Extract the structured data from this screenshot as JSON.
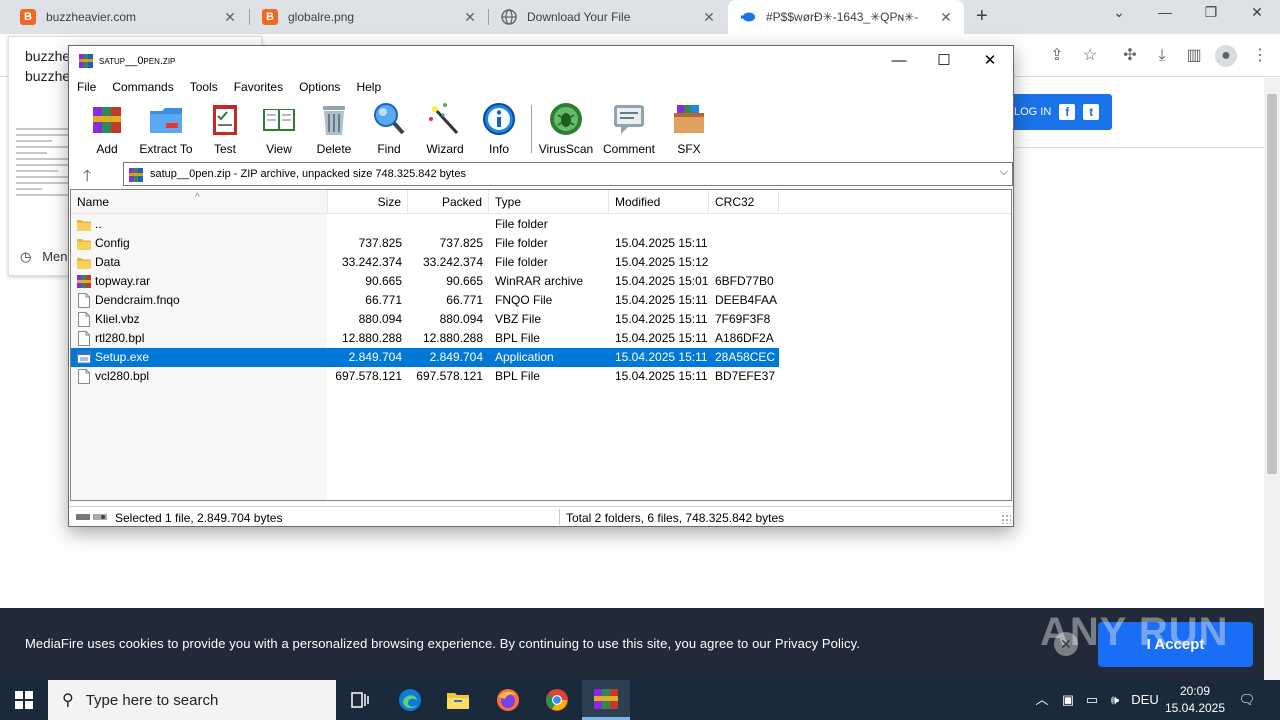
{
  "browser": {
    "tabs": [
      {
        "title": "buzzheavier.com",
        "favicon": "B",
        "favicon_color": "#f26722",
        "active": false
      },
      {
        "title": "globalre.png",
        "favicon": "B",
        "favicon_color": "#f26722",
        "active": false
      },
      {
        "title": "Download Your File",
        "favicon": "globe-icon",
        "favicon_color": "#5f6368",
        "active": false
      },
      {
        "title": "#P$$wørÐ✳-1643_✳QPɴ✳-",
        "favicon": "mediafire-icon",
        "favicon_color": "#1a73e8",
        "active": true
      }
    ],
    "page": {
      "site_title_1": "buzzhe",
      "site_title_2": "buzzhe",
      "menu_label": "Men",
      "login_label": "LOG IN",
      "social_f": "f",
      "social_t": "t"
    },
    "cookie_banner": {
      "text": "MediaFire uses cookies to provide you with a personalized browsing experience. By continuing to use this site, you agree to our Privacy Policy.",
      "accept_label": "I Accept",
      "watermark": "ANY RUN"
    }
  },
  "winrar": {
    "title": "satup__0pen.zip",
    "window_controls": {
      "minimize": "—",
      "maximize": "☐",
      "close": "✕"
    },
    "menu": [
      "File",
      "Commands",
      "Tools",
      "Favorites",
      "Options",
      "Help"
    ],
    "toolbar": [
      {
        "label": "Add",
        "icon": "add-archive-icon"
      },
      {
        "label": "Extract To",
        "icon": "extract-folder-icon"
      },
      {
        "label": "Test",
        "icon": "test-clipboard-icon"
      },
      {
        "label": "View",
        "icon": "view-book-icon"
      },
      {
        "label": "Delete",
        "icon": "trash-icon"
      },
      {
        "label": "Find",
        "icon": "magnifier-icon"
      },
      {
        "label": "Wizard",
        "icon": "magic-wand-icon"
      },
      {
        "label": "Info",
        "icon": "info-icon"
      },
      {
        "label": "VirusScan",
        "icon": "virus-scan-icon"
      },
      {
        "label": "Comment",
        "icon": "comment-icon"
      },
      {
        "label": "SFX",
        "icon": "sfx-box-icon"
      }
    ],
    "address": "satup__0pen.zip - ZIP archive, unpacked size 748.325.842 bytes",
    "columns": [
      "Name",
      "Size",
      "Packed",
      "Type",
      "Modified",
      "CRC32"
    ],
    "files": [
      {
        "name": "..",
        "size": "",
        "packed": "",
        "type": "File folder",
        "modified": "",
        "crc": "",
        "icon": "folder"
      },
      {
        "name": "Config",
        "size": "737.825",
        "packed": "737.825",
        "type": "File folder",
        "modified": "15.04.2025 15:11",
        "crc": "",
        "icon": "folder"
      },
      {
        "name": "Data",
        "size": "33.242.374",
        "packed": "33.242.374",
        "type": "File folder",
        "modified": "15.04.2025 15:12",
        "crc": "",
        "icon": "folder"
      },
      {
        "name": "topway.rar",
        "size": "90.665",
        "packed": "90.665",
        "type": "WinRAR archive",
        "modified": "15.04.2025 15:01",
        "crc": "6BFD77B0",
        "icon": "rar"
      },
      {
        "name": "Dendcraim.fnqo",
        "size": "66.771",
        "packed": "66.771",
        "type": "FNQO File",
        "modified": "15.04.2025 15:11",
        "crc": "DEEB4FAA",
        "icon": "file"
      },
      {
        "name": "Kliel.vbz",
        "size": "880.094",
        "packed": "880.094",
        "type": "VBZ File",
        "modified": "15.04.2025 15:11",
        "crc": "7F69F3F8",
        "icon": "file"
      },
      {
        "name": "rtl280.bpl",
        "size": "12.880.288",
        "packed": "12.880.288",
        "type": "BPL File",
        "modified": "15.04.2025 15:11",
        "crc": "A186DF2A",
        "icon": "file"
      },
      {
        "name": "Setup.exe",
        "size": "2.849.704",
        "packed": "2.849.704",
        "type": "Application",
        "modified": "15.04.2025 15:11",
        "crc": "28A58CEC",
        "icon": "exe",
        "selected": true
      },
      {
        "name": "vcl280.bpl",
        "size": "697.578.121",
        "packed": "697.578.121",
        "type": "BPL File",
        "modified": "15.04.2025 15:11",
        "crc": "BD7EFE37",
        "icon": "file"
      }
    ],
    "status_left": "Selected 1 file, 2.849.704 bytes",
    "status_right": "Total 2 folders, 6 files, 748.325.842 bytes"
  },
  "taskbar": {
    "search_placeholder": "Type here to search",
    "language": "DEU",
    "time": "20:09",
    "date": "15.04.2025"
  }
}
